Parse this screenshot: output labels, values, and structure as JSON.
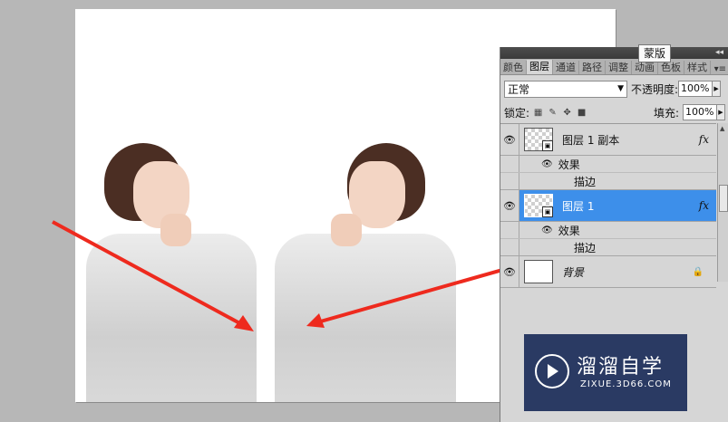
{
  "canvas": {
    "background": "#ffffff"
  },
  "tooltip": "蒙版",
  "panel": {
    "tabs": [
      {
        "label": "颜色",
        "active": false
      },
      {
        "label": "图层",
        "active": true
      },
      {
        "label": "通道",
        "active": false
      },
      {
        "label": "路径",
        "active": false
      },
      {
        "label": "调整",
        "active": false
      },
      {
        "label": "动画",
        "active": false
      },
      {
        "label": "色板",
        "active": false
      },
      {
        "label": "样式",
        "active": false
      }
    ],
    "blend_mode": "正常",
    "opacity_label": "不透明度:",
    "opacity_value": "100%",
    "lock_label": "锁定:",
    "fill_label": "填充:",
    "fill_value": "100%",
    "layers": [
      {
        "name": "图层 1 副本",
        "fx": "fx",
        "effects_label": "效果",
        "effect_item": "描边",
        "selected": false
      },
      {
        "name": "图层 1",
        "fx": "fx",
        "effects_label": "效果",
        "effect_item": "描边",
        "selected": true
      },
      {
        "name": "背景",
        "selected": false,
        "locked": true
      }
    ],
    "selected_color": "#3d8fea"
  },
  "watermark": {
    "title": "溜溜自学",
    "url": "ZIXUE.3D66.COM",
    "background": "#2a3a63"
  },
  "annotations": {
    "arrow_color": "#ee2a1e"
  }
}
